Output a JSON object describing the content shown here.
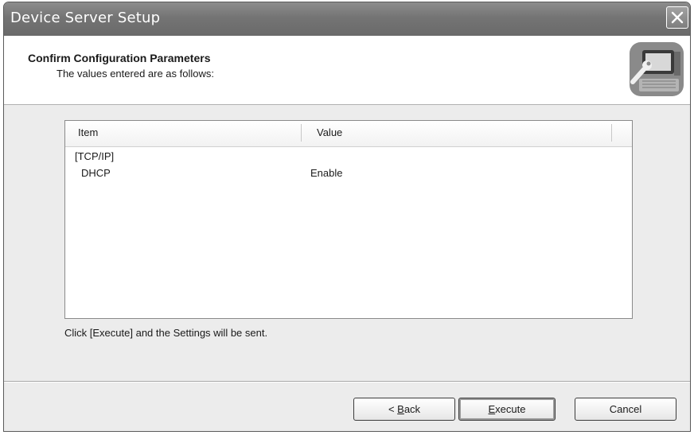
{
  "window": {
    "title": "Device Server Setup"
  },
  "header": {
    "title": "Confirm Configuration Parameters",
    "subtitle": "The values entered are as follows:"
  },
  "list": {
    "columns": [
      "Item",
      "Value"
    ],
    "rows": [
      {
        "item": "[TCP/IP]",
        "value": ""
      },
      {
        "item": "DHCP",
        "value": "Enable"
      }
    ]
  },
  "hint": "Click [Execute] and the Settings will be sent.",
  "buttons": {
    "back": {
      "prefix": "< ",
      "mnemonic": "B",
      "rest": "ack"
    },
    "execute": {
      "mnemonic": "E",
      "rest": "xecute"
    },
    "cancel": "Cancel"
  },
  "icons": {
    "close": "close-icon",
    "header": "computer-wrench-icon"
  }
}
